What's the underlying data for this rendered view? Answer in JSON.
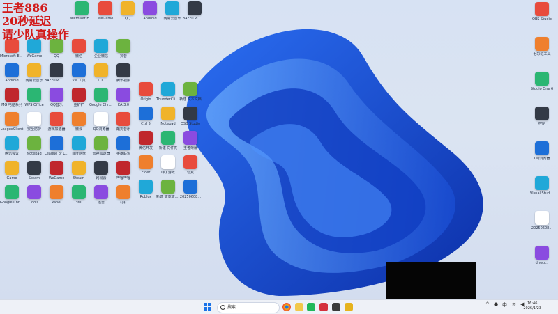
{
  "overlay": {
    "line1": "王者886",
    "line2": "20秒延迟",
    "line3": "请少队真操作"
  },
  "icons": {
    "c0": [
      "Microsoft Edge",
      "WeGame",
      "QQ",
      "Android",
      "网易云音乐",
      "8AFF0 PC 版工具",
      "MG 电脑系列",
      "WPS Office",
      "QQ音乐",
      "LeagueClient",
      "安全防护",
      "游戏加速器",
      "腾讯会议",
      "Notepad",
      "League of Legends",
      "Game",
      "Steam",
      "WeGame",
      "Google Chrome",
      "Tools",
      "Panel"
    ],
    "c1": [
      "微信",
      "企业微信",
      "抖音",
      "VM 工具",
      "LOL",
      "腾讯视频",
      "金铲铲",
      "Google Chrome",
      "EA 3.0",
      "微云",
      "QQ浏览器",
      "酷狗音乐",
      "百度网盘",
      "雷神加速器",
      "英雄联盟",
      "Steam",
      "网易云",
      "哔哩哔哩",
      "360",
      "迅雷",
      "钉钉"
    ],
    "c2": [
      "Origin",
      "ThunderClient",
      "新建 文本文档",
      "Ctrl 5",
      "Notepad",
      "OSB Studio",
      "微信开发",
      "新建 文件夹",
      "王者荣耀",
      "Elder",
      "QQ 游戏",
      "夸克",
      "Roblox",
      "新建 文本文档 (2).txt",
      "20250608..."
    ],
    "right": [
      "OBS Studio",
      "七彩虹工具",
      "Studio One 6",
      "控制",
      "QQ浏览器",
      "Visual Studio Code",
      "20250608...",
      "dnwtr..."
    ]
  },
  "taskbar": {
    "search_placeholder": "搜索",
    "time": "16:46",
    "date": "2026/1/23"
  }
}
